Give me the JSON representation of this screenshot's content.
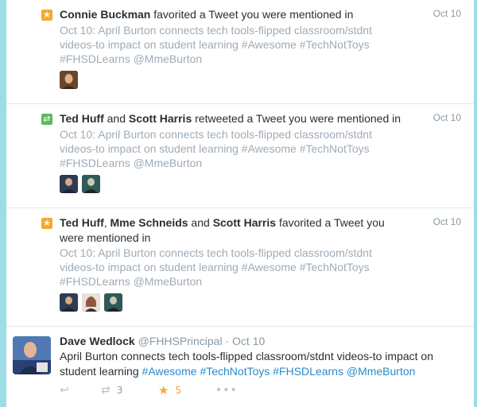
{
  "notifications": [
    {
      "type": "favorite",
      "icon": "star-icon",
      "users": [
        "Connie Buckman"
      ],
      "separators": [],
      "action": "favorited a Tweet you were mentioned in",
      "date": "Oct 10",
      "quoted": "Oct 10: April Burton connects tech tools-flipped classroom/stdnt videos-to impact on student learning #Awesome #TechNotToys #FHSDLearns  @MmeBurton"
    },
    {
      "type": "retweet",
      "icon": "retweet-icon",
      "users": [
        "Ted Huff",
        "Scott Harris"
      ],
      "separators": [
        " and "
      ],
      "action": "retweeted a Tweet you were mentioned in",
      "date": "Oct 10",
      "quoted": "Oct 10: April Burton connects tech tools-flipped classroom/stdnt videos-to impact on student learning #Awesome #TechNotToys #FHSDLearns  @MmeBurton"
    },
    {
      "type": "favorite",
      "icon": "star-icon",
      "users": [
        "Ted Huff",
        "Mme Schneids",
        "Scott Harris"
      ],
      "separators": [
        ", ",
        " and "
      ],
      "action": "favorited a Tweet you were mentioned in",
      "date": "Oct 10",
      "quoted": "Oct 10: April Burton connects tech tools-flipped classroom/stdnt videos-to impact on student learning #Awesome #TechNotToys #FHSDLearns  @MmeBurton"
    }
  ],
  "tweet": {
    "name": "Dave Wedlock",
    "handle": "@FHHSPrincipal",
    "sep": " · ",
    "date": "Oct 10",
    "text": "April Burton connects tech tools-flipped classroom/stdnt videos-to impact on student learning",
    "tags": [
      "#Awesome",
      "#TechNotToys",
      "#FHSDLearns",
      "@MmeBurton"
    ],
    "retweets": "3",
    "favorites": "5"
  },
  "colors": {
    "background": "#9ddde7",
    "favorite": "#f4a92f",
    "retweet": "#5eb95e",
    "link": "#2a8bc7",
    "muted": "#8899a6"
  }
}
